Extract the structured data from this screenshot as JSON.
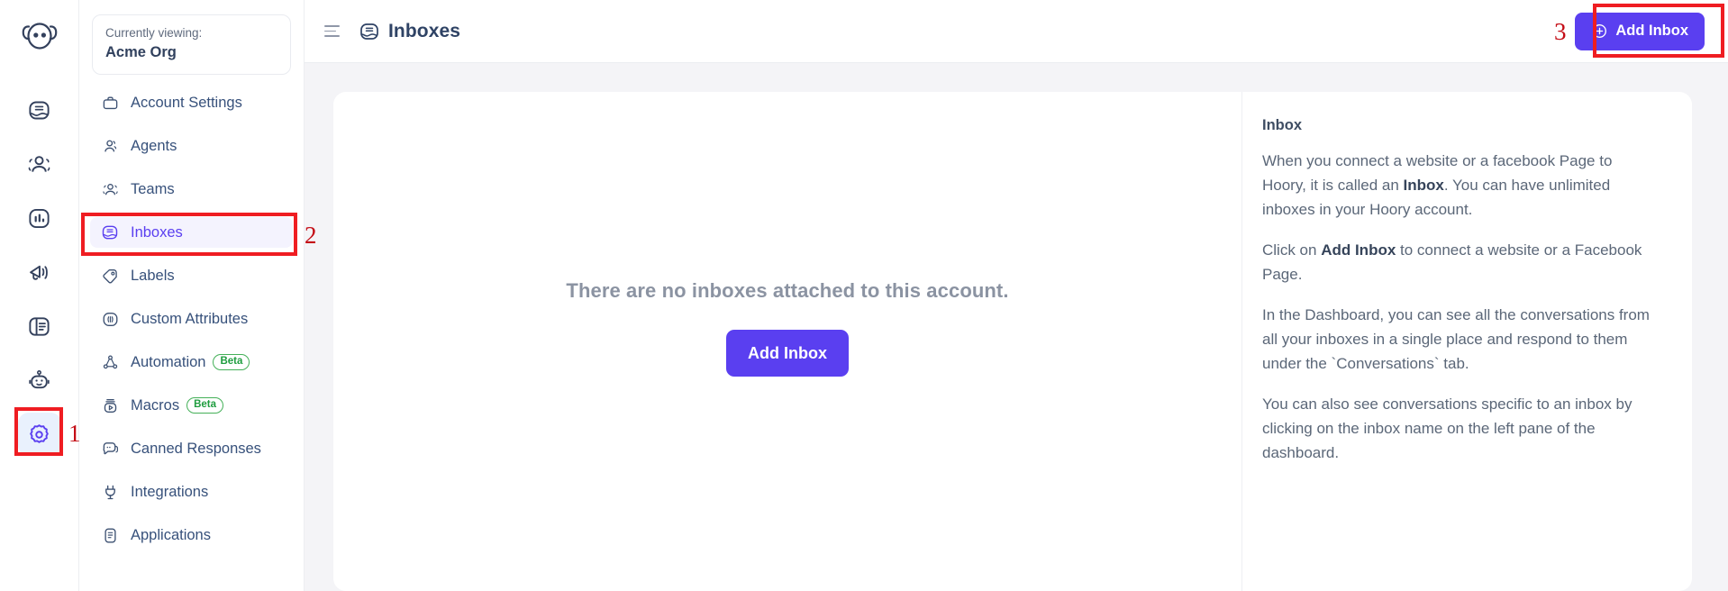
{
  "rail": {
    "logo_name": "hoory-logo",
    "items": [
      {
        "name": "conversations-icon",
        "label": "Conversations",
        "active": false
      },
      {
        "name": "contacts-icon",
        "label": "Contacts",
        "active": false
      },
      {
        "name": "reports-icon",
        "label": "Reports",
        "active": false
      },
      {
        "name": "campaigns-icon",
        "label": "Campaigns",
        "active": false
      },
      {
        "name": "help-center-icon",
        "label": "Help Center",
        "active": false
      },
      {
        "name": "bot-icon",
        "label": "Bot",
        "active": false
      },
      {
        "name": "settings-icon",
        "label": "Settings",
        "active": true
      }
    ]
  },
  "sidebar": {
    "org": {
      "label": "Currently viewing:",
      "name": "Acme Org"
    },
    "items": [
      {
        "label": "Account Settings",
        "icon": "briefcase-icon",
        "badge": "",
        "active": false
      },
      {
        "label": "Agents",
        "icon": "agent-icon",
        "badge": "",
        "active": false
      },
      {
        "label": "Teams",
        "icon": "teams-icon",
        "badge": "",
        "active": false
      },
      {
        "label": "Inboxes",
        "icon": "inbox-icon",
        "badge": "",
        "active": true
      },
      {
        "label": "Labels",
        "icon": "label-tag-icon",
        "badge": "",
        "active": false
      },
      {
        "label": "Custom Attributes",
        "icon": "custom-attributes-icon",
        "badge": "",
        "active": false
      },
      {
        "label": "Automation",
        "icon": "automation-icon",
        "badge": "Beta",
        "active": false
      },
      {
        "label": "Macros",
        "icon": "macros-icon",
        "badge": "Beta",
        "active": false
      },
      {
        "label": "Canned Responses",
        "icon": "canned-responses-icon",
        "badge": "",
        "active": false
      },
      {
        "label": "Integrations",
        "icon": "integrations-icon",
        "badge": "",
        "active": false
      },
      {
        "label": "Applications",
        "icon": "applications-icon",
        "badge": "",
        "active": false
      }
    ]
  },
  "topbar": {
    "menu_toggle": "hamburger-icon",
    "page_icon": "inbox-icon",
    "title": "Inboxes",
    "add_inbox_label": "Add Inbox"
  },
  "empty_state": {
    "message": "There are no inboxes attached to this account.",
    "button_label": "Add Inbox"
  },
  "info_panel": {
    "title": "Inbox",
    "p1_a": "When you connect a website or a facebook Page to Hoory, it is called an ",
    "p1_b": "Inbox",
    "p1_c": ". You can have unlimited inboxes in your Hoory account.",
    "p2_a": "Click on ",
    "p2_b": "Add Inbox",
    "p2_c": " to connect a website or a Facebook Page.",
    "p3": "In the Dashboard, you can see all the conversations from all your inboxes in a single place and respond to them under the `Conversations` tab.",
    "p4": "You can also see conversations specific to an inbox by clicking on the inbox name on the left pane of the dashboard."
  },
  "annotations": {
    "one": "1",
    "two": "2",
    "three": "3"
  },
  "colors": {
    "accent": "#5a3ff0",
    "active_nav_text": "#5a3ff0",
    "active_nav_bg": "#f4f3fe",
    "annotation_red": "#ef1d22",
    "beta_green": "#1f9d3f",
    "page_bg": "#f4f4f7"
  }
}
